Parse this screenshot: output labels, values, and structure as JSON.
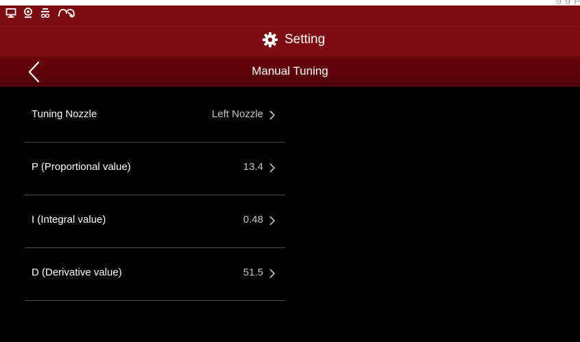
{
  "ghost_text": "g                                                g p",
  "header": {
    "title": "Setting",
    "icon": "gear-icon"
  },
  "status_icons": [
    "monitor-icon",
    "webcam-icon",
    "nozzle-icon",
    "filament-icon"
  ],
  "subheader": {
    "title": "Manual Tuning",
    "back_icon": "chevron-left-icon"
  },
  "rows": [
    {
      "label": "Tuning Nozzle",
      "value": "Left Nozzle"
    },
    {
      "label": "P (Proportional value)",
      "value": "13.4"
    },
    {
      "label": "I (Integral value)",
      "value": "0.48"
    },
    {
      "label": "D (Derivative value)",
      "value": "51.5"
    }
  ],
  "colors": {
    "header_red": "#7b0a12",
    "subheader_red": "#5c0509",
    "background": "#000000",
    "text": "#ffffff",
    "value_text": "#c4c4c4",
    "divider": "#4a4a4a"
  }
}
